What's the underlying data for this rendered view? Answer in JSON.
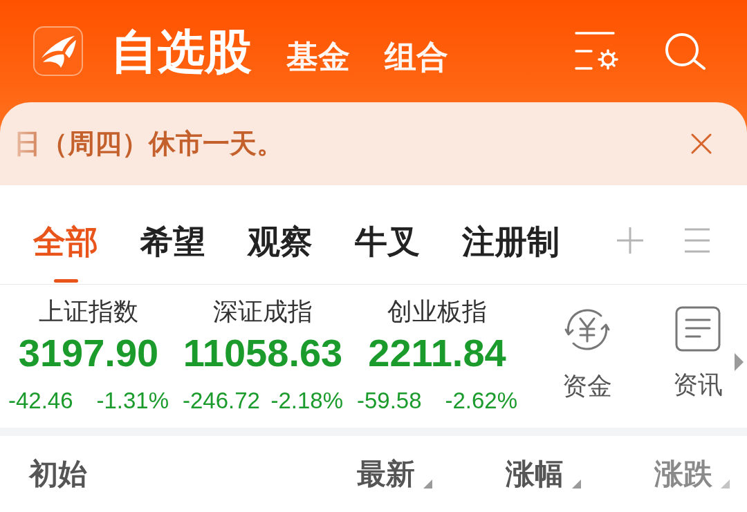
{
  "header": {
    "tabs": [
      {
        "label": "自选股",
        "selected": true
      },
      {
        "label": "基金",
        "selected": false
      },
      {
        "label": "组合",
        "selected": false
      }
    ]
  },
  "notice": {
    "text": "日（周四）休市一天。"
  },
  "groups": {
    "tabs": [
      {
        "label": "全部",
        "selected": true
      },
      {
        "label": "希望",
        "selected": false
      },
      {
        "label": "观察",
        "selected": false
      },
      {
        "label": "牛叉",
        "selected": false
      },
      {
        "label": "注册制",
        "selected": false
      }
    ]
  },
  "indices": [
    {
      "name": "上证指数",
      "value": "3197.90",
      "change": "-42.46",
      "percent": "-1.31%",
      "falling": true
    },
    {
      "name": "深证成指",
      "value": "11058.63",
      "change": "-246.72",
      "percent": "-2.18%",
      "falling": true
    },
    {
      "name": "创业板指",
      "value": "2211.84",
      "change": "-59.58",
      "percent": "-2.62%",
      "falling": true
    }
  ],
  "shortcuts": [
    {
      "label": "资金",
      "kind": "fund"
    },
    {
      "label": "资讯",
      "kind": "news"
    }
  ],
  "columns": [
    {
      "label": "初始",
      "sortable": false
    },
    {
      "label": "最新",
      "sortable": true
    },
    {
      "label": "涨幅",
      "sortable": true
    },
    {
      "label": "涨跌",
      "sortable": true
    }
  ]
}
